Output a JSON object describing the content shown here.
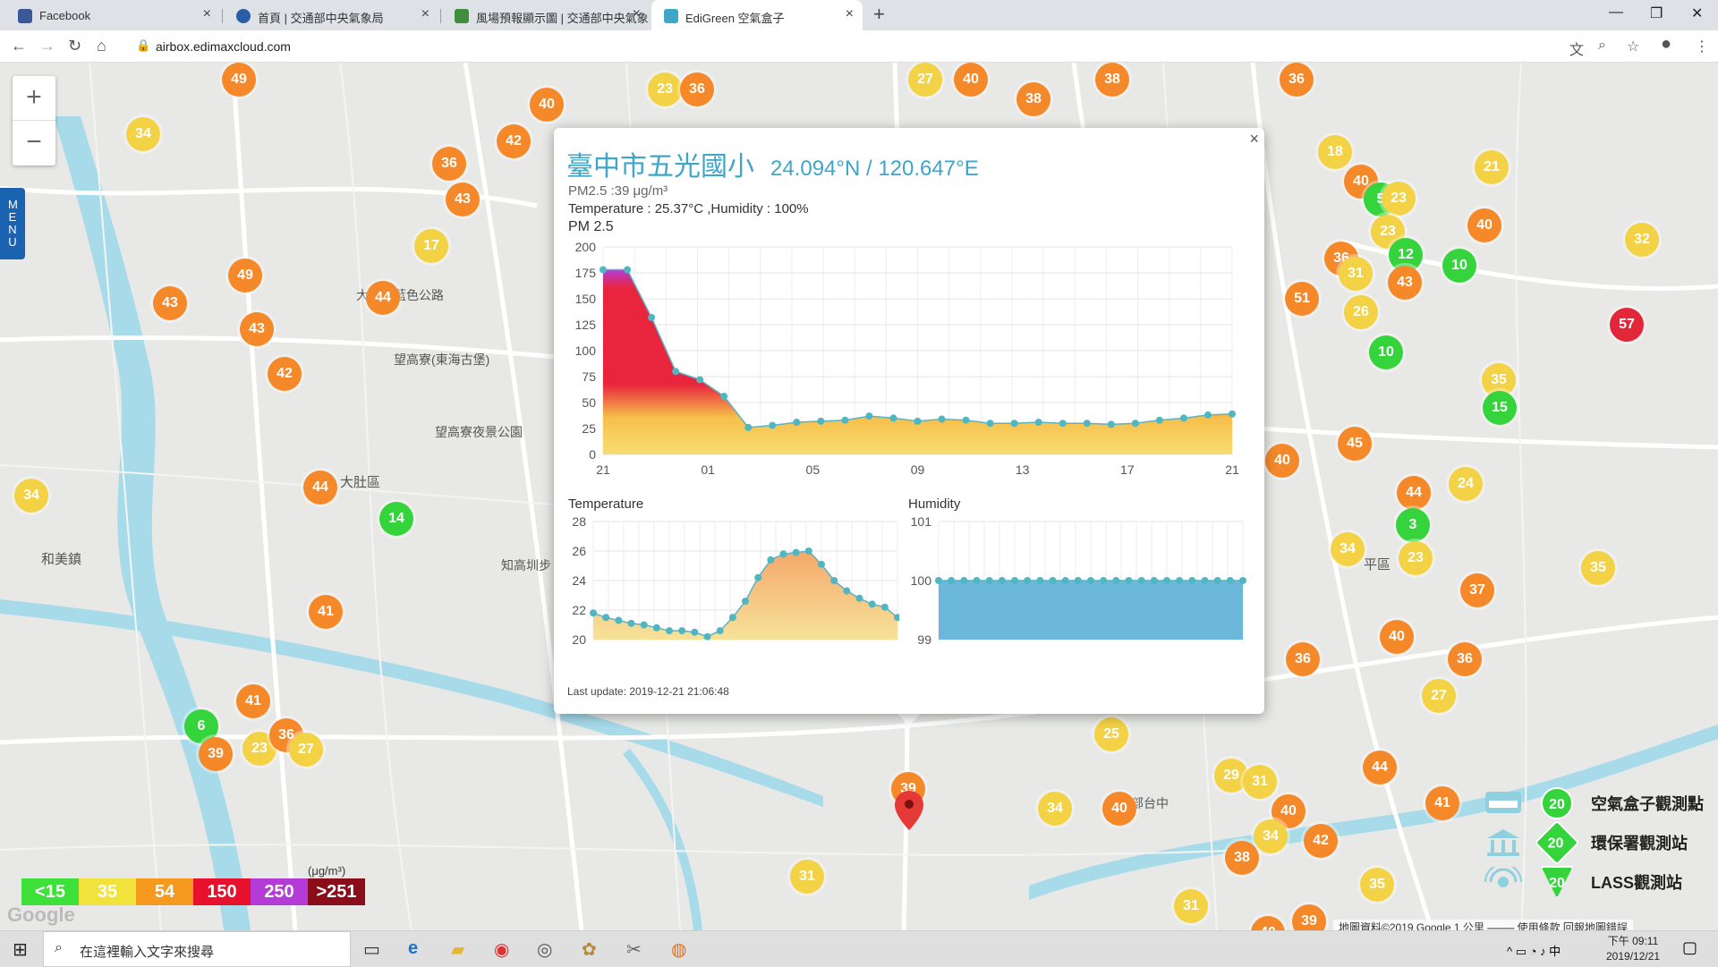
{
  "browser": {
    "tabs": [
      {
        "label": "Facebook",
        "favicon_color": "#3b5998"
      },
      {
        "label": "首頁 | 交通部中央氣象局",
        "favicon_color": "#2a5fa8"
      },
      {
        "label": "風場預報顯示圖 | 交通部中央氣象",
        "favicon_color": "#3f8f3f"
      },
      {
        "label": "EdiGreen 空氣盒子",
        "favicon_color": "#3fa6c8"
      }
    ],
    "new_tab": "+",
    "url": "airbox.edimaxcloud.com"
  },
  "map": {
    "menu_label": "MENU",
    "zoom_in": "+",
    "zoom_out": "−",
    "place_labels": [
      {
        "text": "大肚區"
      },
      {
        "text": "大肚山藍色公路"
      },
      {
        "text": "望高寮(東海古堡)"
      },
      {
        "text": "望高寮夜景公園"
      },
      {
        "text": "和美鎮"
      },
      {
        "text": "知高圳步"
      },
      {
        "text": "平區"
      },
      {
        "text": "經濟部台中"
      }
    ],
    "markers": [
      {
        "v": "49",
        "c": "o"
      },
      {
        "v": "34",
        "c": "y"
      },
      {
        "v": "40",
        "c": "o"
      },
      {
        "v": "42",
        "c": "o"
      },
      {
        "v": "36",
        "c": "o"
      },
      {
        "v": "43",
        "c": "o"
      },
      {
        "v": "17",
        "c": "y"
      },
      {
        "v": "49",
        "c": "o"
      },
      {
        "v": "43",
        "c": "o"
      },
      {
        "v": "44",
        "c": "o"
      },
      {
        "v": "43",
        "c": "o"
      },
      {
        "v": "42",
        "c": "o"
      },
      {
        "v": "44",
        "c": "o"
      },
      {
        "v": "34",
        "c": "y"
      },
      {
        "v": "14",
        "c": "g"
      },
      {
        "v": "41",
        "c": "o"
      },
      {
        "v": "41",
        "c": "o"
      },
      {
        "v": "6",
        "c": "g"
      },
      {
        "v": "39",
        "c": "o"
      },
      {
        "v": "23",
        "c": "y"
      },
      {
        "v": "36",
        "c": "o"
      },
      {
        "v": "27",
        "c": "y"
      },
      {
        "v": "23",
        "c": "y"
      },
      {
        "v": "36",
        "c": "o"
      },
      {
        "v": "27",
        "c": "y"
      },
      {
        "v": "40",
        "c": "o"
      },
      {
        "v": "38",
        "c": "o"
      },
      {
        "v": "38",
        "c": "o"
      },
      {
        "v": "36",
        "c": "o"
      },
      {
        "v": "18",
        "c": "y"
      },
      {
        "v": "40",
        "c": "o"
      },
      {
        "v": "5",
        "c": "g"
      },
      {
        "v": "23",
        "c": "y"
      },
      {
        "v": "23",
        "c": "y"
      },
      {
        "v": "21",
        "c": "y"
      },
      {
        "v": "40",
        "c": "o"
      },
      {
        "v": "32",
        "c": "y"
      },
      {
        "v": "12",
        "c": "g"
      },
      {
        "v": "36",
        "c": "o"
      },
      {
        "v": "31",
        "c": "y"
      },
      {
        "v": "43",
        "c": "o"
      },
      {
        "v": "10",
        "c": "g"
      },
      {
        "v": "51",
        "c": "o"
      },
      {
        "v": "26",
        "c": "y"
      },
      {
        "v": "10",
        "c": "g"
      },
      {
        "v": "57",
        "c": "r"
      },
      {
        "v": "35",
        "c": "y"
      },
      {
        "v": "15",
        "c": "g"
      },
      {
        "v": "40",
        "c": "o"
      },
      {
        "v": "45",
        "c": "o"
      },
      {
        "v": "44",
        "c": "o"
      },
      {
        "v": "24",
        "c": "y"
      },
      {
        "v": "3",
        "c": "g"
      },
      {
        "v": "34",
        "c": "y"
      },
      {
        "v": "23",
        "c": "y"
      },
      {
        "v": "35",
        "c": "y"
      },
      {
        "v": "37",
        "c": "o"
      },
      {
        "v": "40",
        "c": "o"
      },
      {
        "v": "36",
        "c": "o"
      },
      {
        "v": "36",
        "c": "o"
      },
      {
        "v": "27",
        "c": "y"
      },
      {
        "v": "25",
        "c": "y"
      },
      {
        "v": "44",
        "c": "o"
      },
      {
        "v": "41",
        "c": "o"
      },
      {
        "v": "29",
        "c": "y"
      },
      {
        "v": "31",
        "c": "y"
      },
      {
        "v": "40",
        "c": "o"
      },
      {
        "v": "34",
        "c": "y"
      },
      {
        "v": "40",
        "c": "o"
      },
      {
        "v": "34",
        "c": "y"
      },
      {
        "v": "42",
        "c": "o"
      },
      {
        "v": "38",
        "c": "o"
      },
      {
        "v": "31",
        "c": "y"
      },
      {
        "v": "31",
        "c": "y"
      },
      {
        "v": "35",
        "c": "y"
      },
      {
        "v": "39",
        "c": "o"
      },
      {
        "v": "40",
        "c": "o"
      },
      {
        "v": "39",
        "c": "o"
      }
    ],
    "legend": [
      {
        "label": "<15",
        "color": "#3ee03a"
      },
      {
        "label": "35",
        "color": "#f2e33c"
      },
      {
        "label": "54",
        "color": "#f59a1f"
      },
      {
        "label": "150",
        "color": "#e8112d"
      },
      {
        "label": "250",
        "color": "#b53bd6"
      },
      {
        "label": ">251",
        "color": "#8c0d1a"
      }
    ],
    "legend_unit": "(μg/m³)",
    "google_logo": "Google",
    "attribution": "地圖資料©2019 Google   1 公里 ⎯⎯⎯⎯⎯   使用條款   回報地圖錯誤",
    "station_key": [
      {
        "value": "20",
        "label": "空氣盒子觀測點"
      },
      {
        "value": "20",
        "label": "環保署觀測站"
      },
      {
        "value": "20",
        "label": "LASS觀測站"
      }
    ]
  },
  "popup": {
    "close": "×",
    "station": "臺中市五光國小",
    "coords": "24.094°N / 120.647°E",
    "pm25_line": "PM2.5 :39 μg/m³",
    "temp_hum_line": "Temperature : 25.37°C ,Humidity : 100%",
    "pm_heading": "PM 2.5",
    "temp_heading": "Temperature",
    "hum_heading": "Humidity",
    "last_update": "Last update: 2019-12-21 21:06:48",
    "selected_marker": "39"
  },
  "chart_data": [
    {
      "type": "area",
      "title": "PM 2.5",
      "x_ticks": [
        "21",
        "01",
        "05",
        "09",
        "13",
        "17",
        "21"
      ],
      "ylim": [
        0,
        200
      ],
      "y_ticks": [
        0,
        25,
        50,
        75,
        100,
        125,
        150,
        175,
        200
      ],
      "values": [
        178,
        178,
        132,
        80,
        72,
        56,
        26,
        28,
        31,
        32,
        33,
        37,
        35,
        32,
        34,
        33,
        30,
        30,
        31,
        30,
        30,
        29,
        30,
        33,
        35,
        38,
        39
      ],
      "grid": true
    },
    {
      "type": "area",
      "title": "Temperature",
      "ylim": [
        20,
        28
      ],
      "y_ticks": [
        20,
        22,
        24,
        26,
        28
      ],
      "values": [
        21.8,
        21.5,
        21.3,
        21.1,
        21.0,
        20.8,
        20.6,
        20.6,
        20.5,
        20.2,
        20.6,
        21.5,
        22.6,
        24.2,
        25.4,
        25.8,
        25.9,
        26.0,
        25.1,
        24.0,
        23.3,
        22.8,
        22.4,
        22.2,
        21.5
      ],
      "grid": true
    },
    {
      "type": "area",
      "title": "Humidity",
      "ylim": [
        99,
        101
      ],
      "y_ticks": [
        99,
        100,
        101
      ],
      "values": [
        100,
        100,
        100,
        100,
        100,
        100,
        100,
        100,
        100,
        100,
        100,
        100,
        100,
        100,
        100,
        100,
        100,
        100,
        100,
        100,
        100,
        100,
        100,
        100,
        100
      ],
      "grid": true
    }
  ],
  "taskbar": {
    "search_placeholder": "在這裡輸入文字來搜尋",
    "time": "下午 09:11",
    "date": "2019/12/21"
  }
}
